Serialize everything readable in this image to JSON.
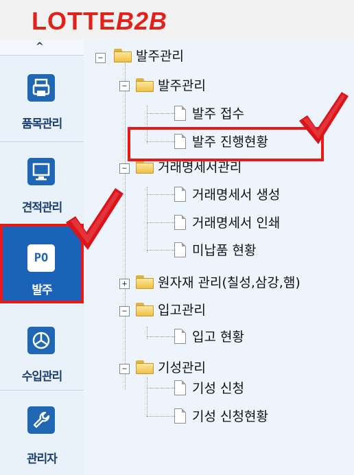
{
  "brand": {
    "logo_main": "LOTTE",
    "logo_suffix": "B2B"
  },
  "sidebar": {
    "scroll_up_glyph": "^",
    "items": [
      {
        "label": "품목관리",
        "icon": "printer-icon"
      },
      {
        "label": "견적관리",
        "icon": "monitor-icon"
      },
      {
        "label": "발주",
        "icon": "po-icon",
        "icon_text": "PO",
        "active": true
      },
      {
        "label": "수입관리",
        "icon": "pie-chart-icon"
      },
      {
        "label": "관리자",
        "icon": "wrench-icon"
      }
    ]
  },
  "tree": {
    "root": {
      "label": "발주관리",
      "toggle": "−"
    },
    "groups": [
      {
        "label": "발주관리",
        "toggle": "−",
        "children": [
          "발주 접수",
          "발주 진행현황"
        ]
      },
      {
        "label": "거래명세서관리",
        "toggle": "−",
        "children": [
          "거래명세서 생성",
          "거래명세서 인쇄",
          "미납품 현황"
        ]
      },
      {
        "label": "원자재 관리(칠성,삼강,햄)",
        "toggle": "+",
        "children": []
      },
      {
        "label": "입고관리",
        "toggle": "−",
        "children": [
          "입고 현황"
        ]
      },
      {
        "label": "기성관리",
        "toggle": "−",
        "children": [
          "기성 신청",
          "기성 신청현황"
        ]
      }
    ]
  },
  "annotations": {
    "highlight_item": "발주 진행현황",
    "mark_color": "#e81919"
  },
  "colors": {
    "brand_red": "#e1221b",
    "nav_blue": "#1b62b9",
    "tree_bg": "#eef4fb"
  }
}
